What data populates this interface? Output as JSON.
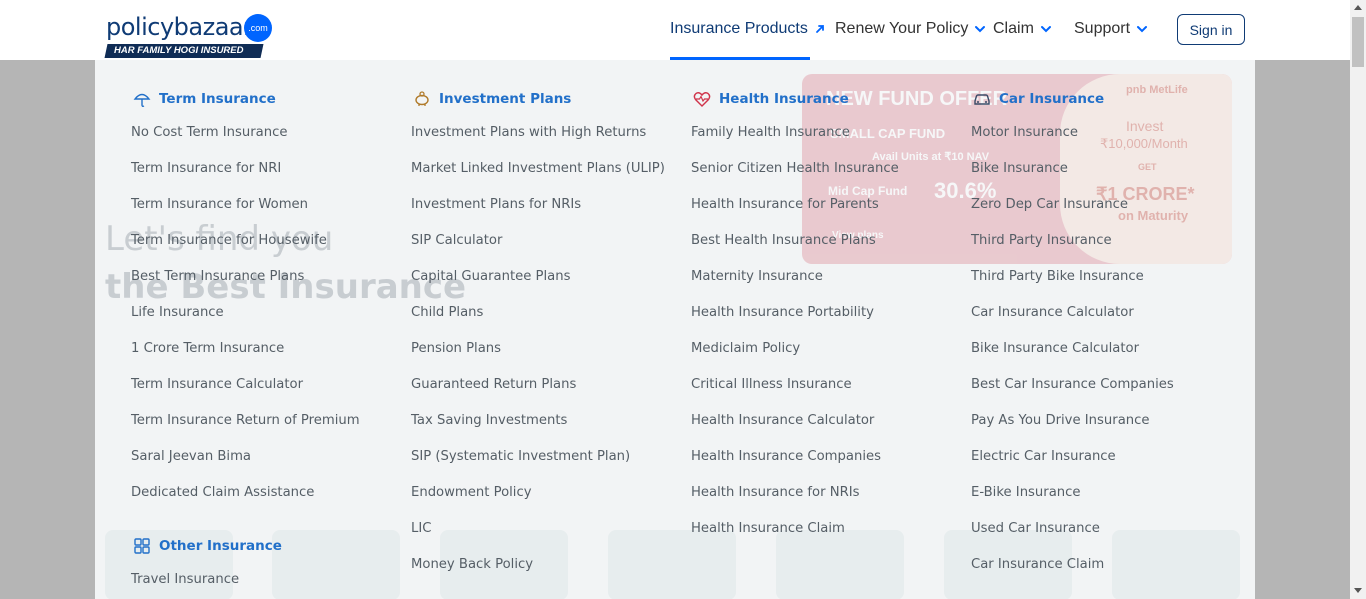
{
  "header": {
    "logo_word": "policybazaar",
    "logo_badge": ".com",
    "logo_tagline": "HAR FAMILY HOGI INSURED",
    "nav": [
      {
        "label": "Insurance Products"
      },
      {
        "label": "Renew Your Policy"
      },
      {
        "label": "Claim"
      },
      {
        "label": "Support"
      }
    ],
    "signin_label": "Sign in"
  },
  "menu": {
    "columns": [
      {
        "title": "Term Insurance",
        "icon": "umbrella-icon",
        "links": [
          "No Cost Term Insurance",
          "Term Insurance for NRI",
          "Term Insurance for Women",
          "Term Insurance for Housewife",
          "Best Term Insurance Plans",
          "Life Insurance",
          "1 Crore Term Insurance",
          "Term Insurance Calculator",
          "Term Insurance Return of Premium",
          "Saral Jeevan Bima",
          "Dedicated Claim Assistance"
        ]
      },
      {
        "title": "Investment Plans",
        "icon": "piggy-bank-icon",
        "links": [
          "Investment Plans with High Returns",
          "Market Linked Investment Plans (ULIP)",
          "Investment Plans for NRIs",
          "SIP Calculator",
          "Capital Guarantee Plans",
          "Child Plans",
          "Pension Plans",
          "Guaranteed Return Plans",
          "Tax Saving Investments",
          "SIP (Systematic Investment Plan)",
          "Endowment Policy",
          "LIC",
          "Money Back Policy"
        ]
      },
      {
        "title": "Health Insurance",
        "icon": "heart-pulse-icon",
        "links": [
          "Family Health Insurance",
          "Senior Citizen Health Insurance",
          "Health Insurance for Parents",
          "Best Health Insurance Plans",
          "Maternity Insurance",
          "Health Insurance Portability",
          "Mediclaim Policy",
          "Critical Illness Insurance",
          "Health Insurance Calculator",
          "Health Insurance Companies",
          "Health Insurance for NRIs",
          "Health Insurance Claim"
        ]
      },
      {
        "title": "Car Insurance",
        "icon": "car-icon",
        "links": [
          "Motor Insurance",
          "Bike Insurance",
          "Zero Dep Car Insurance",
          "Third Party Insurance",
          "Third Party Bike Insurance",
          "Car Insurance Calculator",
          "Bike Insurance Calculator",
          "Best Car Insurance Companies",
          "Pay As You Drive Insurance",
          "Electric Car Insurance",
          "E-Bike Insurance",
          "Used Car Insurance",
          "Car Insurance Claim"
        ]
      }
    ],
    "other": {
      "title": "Other Insurance",
      "icon": "grid-icon",
      "links": [
        "Travel Insurance"
      ]
    }
  },
  "background": {
    "banner_headline": "NEW FUND OFFER",
    "banner_fund": "SMALL CAP FUND",
    "banner_units": "Avail Units at ₹10 NAV",
    "banner_return_label": "Mid Cap Fund",
    "banner_return_value": "30.6%",
    "banner_cta": "View plans",
    "promo_brand": "pnb MetLife",
    "promo_invest": "Invest",
    "promo_amount": "₹10,000/Month",
    "promo_get": "GET",
    "promo_crore": "₹1 CRORE*",
    "promo_maturity": "on Maturity",
    "hero_line1": "Let's find you",
    "hero_line2": "the Best Insurance"
  },
  "colors": {
    "brand_blue": "#0065ff",
    "brand_navy": "#0f3b75",
    "menu_title_blue": "#2270c9",
    "menu_link_gray": "#555e66",
    "overlay_gray": "#b5b5b5",
    "panel_bg": "#f2f4f5"
  }
}
